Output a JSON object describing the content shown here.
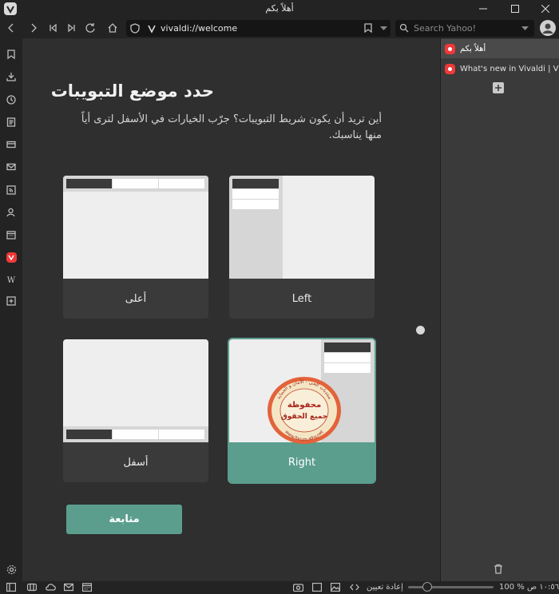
{
  "window": {
    "title": "أهلاً بكم"
  },
  "address_bar": {
    "url": "vivaldi://welcome"
  },
  "search": {
    "placeholder": "Search Yahoo!"
  },
  "page": {
    "heading": "حدد موضع التبويبات",
    "description": "أين تريد أن يكون شريط التبويبات؟ جرّب الخيارات في الأسفل لترى أياً منها يناسبك.",
    "options": [
      {
        "id": "top",
        "label": "أعلى",
        "selected": false
      },
      {
        "id": "left",
        "label": "Left",
        "selected": false
      },
      {
        "id": "bottom",
        "label": "أسفل",
        "selected": false
      },
      {
        "id": "right",
        "label": "Right",
        "selected": true
      }
    ],
    "continue_label": "متابعة"
  },
  "tabs": [
    {
      "title": "أهلاً بكم",
      "active": true
    },
    {
      "title": "What's new in Vivaldi | Vivaldi",
      "active": false
    }
  ],
  "statusbar": {
    "reset_label": "إعادة تعيين",
    "zoom": "100 %",
    "clock": "١٠:٥٦ ص"
  },
  "stamp": {
    "arc_text": "منتديات الحي - الأمان و الحماية",
    "center_line1": "محفوظة",
    "center_line2": "جميع الحقوق",
    "url": "www.forum.alhy.net"
  },
  "colors": {
    "accent": "#5b9e8e",
    "vivaldi_red": "#ef3939",
    "background": "#2f2f2f"
  }
}
